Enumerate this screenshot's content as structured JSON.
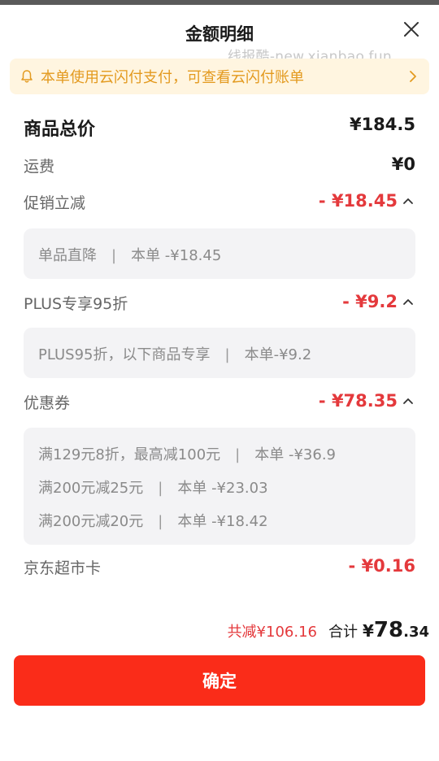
{
  "header": {
    "title": "金额明细",
    "watermark": "线报酷-new.xianbao.fun"
  },
  "notice": {
    "text": "本单使用云闪付支付，可查看云闪付账单",
    "icon": "bell-icon",
    "color": "#e39a1f"
  },
  "summary": {
    "goods_total": {
      "label": "商品总价",
      "value": "¥184.5"
    },
    "shipping": {
      "label": "运费",
      "value": "¥0"
    },
    "promotion": {
      "label": "促销立减",
      "value": "- ¥18.45",
      "details": [
        {
          "name": "单品直降",
          "sep": "|",
          "amount": "本单 -¥18.45"
        }
      ]
    },
    "plus": {
      "label": "PLUS专享95折",
      "value": "- ¥9.2",
      "details": [
        {
          "name": "PLUS95折，以下商品专享",
          "sep": "|",
          "amount": "本单-¥9.2"
        }
      ]
    },
    "coupon": {
      "label": "优惠券",
      "value": "- ¥78.35",
      "details": [
        {
          "name": "满129元8折，最高减100元",
          "sep": "|",
          "amount": "本单 -¥36.9"
        },
        {
          "name": "满200元减25元",
          "sep": "|",
          "amount": "本单 -¥23.03"
        },
        {
          "name": "满200元减20元",
          "sep": "|",
          "amount": "本单 -¥18.42"
        }
      ]
    },
    "supermarket_card": {
      "label": "京东超市卡",
      "value": "- ¥0.16"
    }
  },
  "footer": {
    "saved": "共减¥106.16",
    "total_label": "合计",
    "currency": "¥",
    "total_int": "78",
    "total_dec": ".34",
    "confirm_label": "确定"
  },
  "colors": {
    "accent_red": "#e4393c",
    "button_red": "#fa2c19",
    "notice_bg": "#fff5e0"
  }
}
